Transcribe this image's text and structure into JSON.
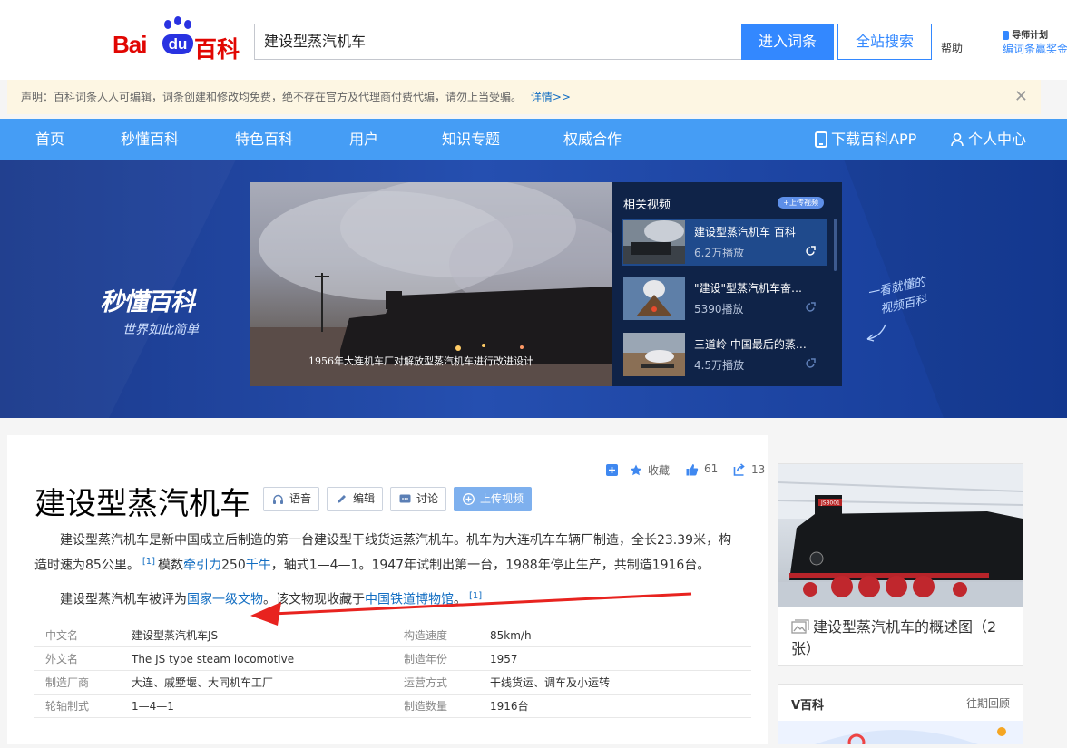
{
  "header": {
    "logo_bai": "Bai",
    "logo_du": "du",
    "logo_baike": "百科",
    "search_value": "建设型蒸汽机车",
    "enter_button": "进入词条",
    "site_search_button": "全站搜索",
    "help": "帮助",
    "mentor_title": "导师计划",
    "mentor_sub": "编词条赢奖金"
  },
  "notice": {
    "text": "声明：百科词条人人可编辑，词条创建和修改均免费，绝不存在官方及代理商付费代编，请勿上当受骗。",
    "link": "详情>>",
    "close": "✕"
  },
  "nav": {
    "items": [
      "首页",
      "秒懂百科",
      "特色百科",
      "用户",
      "知识专题",
      "权威合作"
    ],
    "download_app": "下载百科APP",
    "personal_center": "个人中心"
  },
  "banner": {
    "brand": "秒懂百科",
    "slogan": "世界如此简单",
    "handwriting_line1": "一看就懂的",
    "handwriting_line2": "视频百科",
    "video_caption": "1956年大连机车厂对解放型蒸汽机车进行改进设计",
    "side_title": "相关视频",
    "upload_video": "+上传视频",
    "videos": [
      {
        "name": "建设型蒸汽机车 百科",
        "plays": "6.2万播放"
      },
      {
        "name": "\"建设\"型蒸汽机车奋…",
        "plays": "5390播放"
      },
      {
        "name": "三道岭 中国最后的蒸…",
        "plays": "4.5万播放"
      }
    ]
  },
  "article": {
    "title": "建设型蒸汽机车",
    "tools": [
      "语音",
      "编辑",
      "讨论",
      "上传视频"
    ],
    "actions": {
      "favorite": "收藏",
      "likes": "61",
      "shares": "13"
    },
    "summary1_a": "建设型蒸汽机车是新中国成立后制造的第一台建设型干线货运蒸汽机车。机车为大连机车车辆厂制造，全长23.39米，构造时速为85公里。",
    "summary1_ref": "[1]",
    "summary1_b": "模数",
    "summary1_link1": "牵引力",
    "summary1_c": "250",
    "summary1_link2": "千牛",
    "summary1_d": "，轴式1—4—1。1947年试制出第一台，1988年停止生产，共制造1916台。",
    "summary2_a": "建设型蒸汽机车被评为",
    "summary2_link1": "国家一级文物",
    "summary2_b": "。该文物现收藏于",
    "summary2_link2": "中国铁道博物馆",
    "summary2_c": "。",
    "summary2_ref": "[1]",
    "infobox": [
      {
        "k1": "中文名",
        "v1": "建设型蒸汽机车JS",
        "k2": "构造速度",
        "v2": "85km/h"
      },
      {
        "k1": "外文名",
        "v1": "The JS type steam locomotive",
        "k2": "制造年份",
        "v2": "1957"
      },
      {
        "k1": "制造厂商",
        "v1": "大连、戚墅堰、大同机车工厂",
        "k2": "运营方式",
        "v2": "干线货运、调车及小运转"
      },
      {
        "k1": "轮轴制式",
        "v1": "1—4—1",
        "k2": "制造数量",
        "v2": "1916台"
      }
    ]
  },
  "sidebar": {
    "picture_caption": "建设型蒸汽机车的概述图（2张）",
    "vbaike_title": "V百科",
    "vbaike_more": "往期回顾",
    "loco_number": "JS8001"
  },
  "colors": {
    "nav": "#459df5",
    "brand_red": "#e10602",
    "brand_blue": "#2932e1",
    "link": "#136ec2",
    "annotation_arrow": "#e8231f"
  }
}
